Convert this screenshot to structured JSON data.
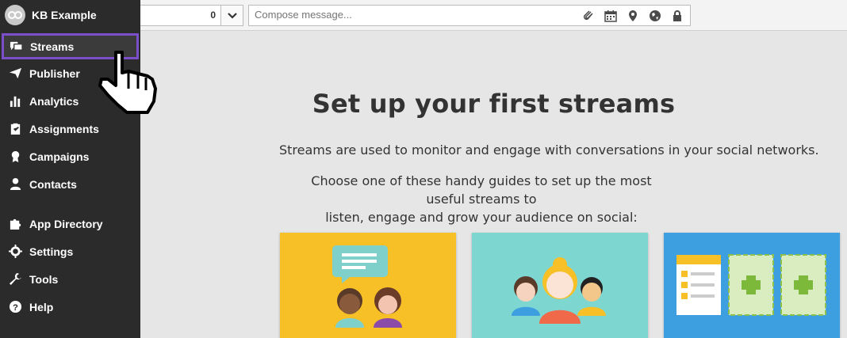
{
  "sidebar": {
    "org_name": "KB Example",
    "items": [
      {
        "label": "Streams",
        "icon": "streams-icon",
        "active": true
      },
      {
        "label": "Publisher",
        "icon": "paper-plane-icon"
      },
      {
        "label": "Analytics",
        "icon": "bar-chart-icon"
      },
      {
        "label": "Assignments",
        "icon": "clipboard-icon"
      },
      {
        "label": "Campaigns",
        "icon": "campaign-icon"
      },
      {
        "label": "Contacts",
        "icon": "person-icon"
      },
      {
        "label": "App Directory",
        "icon": "puzzle-icon"
      },
      {
        "label": "Settings",
        "icon": "gear-icon"
      },
      {
        "label": "Tools",
        "icon": "wrench-icon"
      },
      {
        "label": "Help",
        "icon": "question-icon"
      }
    ]
  },
  "topbar": {
    "selected_profiles_count": "0",
    "compose_placeholder": "Compose message...",
    "compose_icons": [
      "paperclip-icon",
      "calendar-icon",
      "location-pin-icon",
      "globe-icon",
      "lock-icon"
    ]
  },
  "main": {
    "title": "Set up your first streams",
    "intro": "Streams are used to monitor and engage with conversations in your social networks.",
    "guide_line1": "Choose one of these handy guides to set up the most useful streams to",
    "guide_line2": "listen, engage and grow your audience on social:"
  },
  "colors": {
    "sidebar_bg": "#2b2b2b",
    "active_border": "#7b4fc9",
    "card1_bg": "#f6c026",
    "card2_bg": "#7dd6cf",
    "card3_bg": "#3e9fe0"
  }
}
